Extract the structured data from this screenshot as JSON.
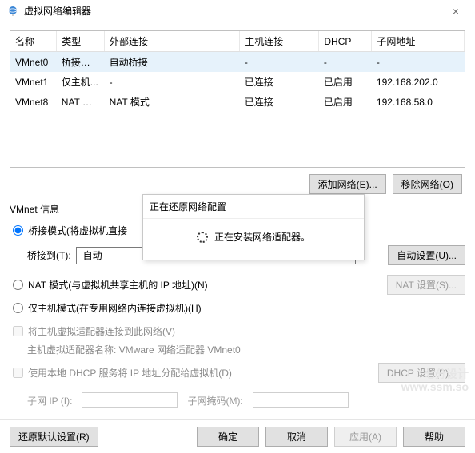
{
  "window": {
    "title": "虚拟网络编辑器",
    "close": "×"
  },
  "columns": [
    "名称",
    "类型",
    "外部连接",
    "主机连接",
    "DHCP",
    "子网地址"
  ],
  "colwidths": [
    "56",
    "58",
    "164",
    "96",
    "64",
    "112"
  ],
  "rows": [
    {
      "name": "VMnet0",
      "type": "桥接模式",
      "ext": "自动桥接",
      "host": "-",
      "dhcp": "-",
      "subnet": "-",
      "selected": true
    },
    {
      "name": "VMnet1",
      "type": "仅主机...",
      "ext": "-",
      "host": "已连接",
      "dhcp": "已启用",
      "subnet": "192.168.202.0",
      "selected": false
    },
    {
      "name": "VMnet8",
      "type": "NAT 模式",
      "ext": "NAT 模式",
      "host": "已连接",
      "dhcp": "已启用",
      "subnet": "192.168.58.0",
      "selected": false
    }
  ],
  "buttons": {
    "add_net": "添加网络(E)...",
    "remove_net": "移除网络(O)",
    "auto_set": "自动设置(U)...",
    "nat_set": "NAT 设置(S)...",
    "dhcp_set": "DHCP 设置(P)...",
    "restore": "还原默认设置(R)",
    "ok": "确定",
    "cancel": "取消",
    "apply": "应用(A)",
    "help": "帮助"
  },
  "labels": {
    "vmnet_info": "VMnet 信息",
    "bridge": "桥接模式(将虚拟机直接",
    "bridge_to": "桥接到(T):",
    "bridge_sel": "自动",
    "nat": "NAT 模式(与虚拟机共享主机的 IP 地址)(N)",
    "hostonly": "仅主机模式(在专用网络内连接虚拟机)(H)",
    "connect_host": "将主机虚拟适配器连接到此网络(V)",
    "adapter_name": "主机虚拟适配器名称: VMware 网络适配器 VMnet0",
    "use_dhcp": "使用本地 DHCP 服务将 IP 地址分配给虚拟机(D)",
    "subnet_ip": "子网 IP (I):",
    "subnet_mask": "子网掩码(M):"
  },
  "overlay": {
    "title": "正在还原网络配置",
    "body": "正在安装网络适配器。"
  },
  "watermark": {
    "l1": "七分设计",
    "l2": "www.ssm.so"
  }
}
